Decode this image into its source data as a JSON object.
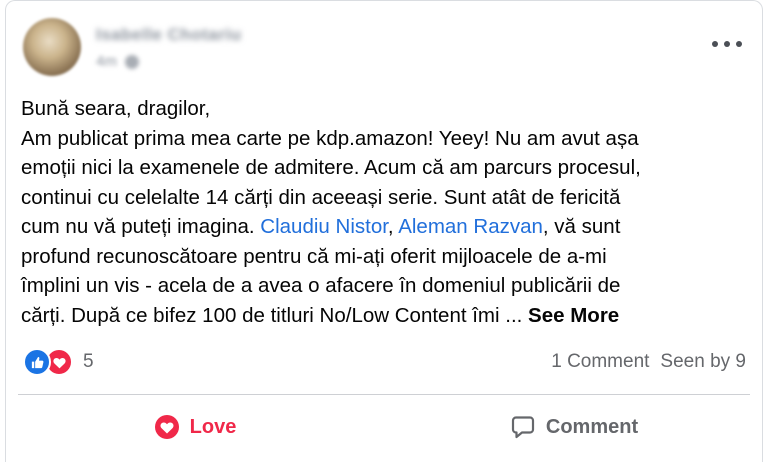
{
  "post": {
    "author": "Isabelle Chotariu",
    "time": "4m",
    "text_lines": [
      "Bună seara, dragilor,",
      "Am publicat prima mea carte pe kdp.amazon! Yeey! Nu am avut așa",
      "emoții nici la examenele de admitere. Acum că am parcurs procesul,",
      "continui cu celelalte 14 cărți din aceeași serie. Sunt atât de fericită",
      "cum nu vă puteți imagina. "
    ],
    "mention_1": "Claudiu Nistor",
    "sep_1": ", ",
    "mention_2": "Aleman Razvan",
    "after_mentions": ", vă sunt",
    "text_lines_2": [
      "profund recunoscătoare pentru că mi-ați oferit mijloacele de a-mi",
      "împlini un vis - acela de a avea o afacere în domeniul publicării de"
    ],
    "last_line": "cărți. După ce bifez 100 de titluri No/Low Content îmi ... ",
    "see_more": "See More"
  },
  "reactions": {
    "types": [
      "like-icon",
      "love-icon"
    ],
    "count": "5",
    "comments": "1 Comment",
    "seen": "Seen by 9"
  },
  "actions": {
    "love_label": "Love",
    "comment_label": "Comment"
  },
  "colors": {
    "mention": "#216fdb",
    "love": "#f02849",
    "like": "#1b74e4",
    "secondary_text": "#65676b"
  }
}
